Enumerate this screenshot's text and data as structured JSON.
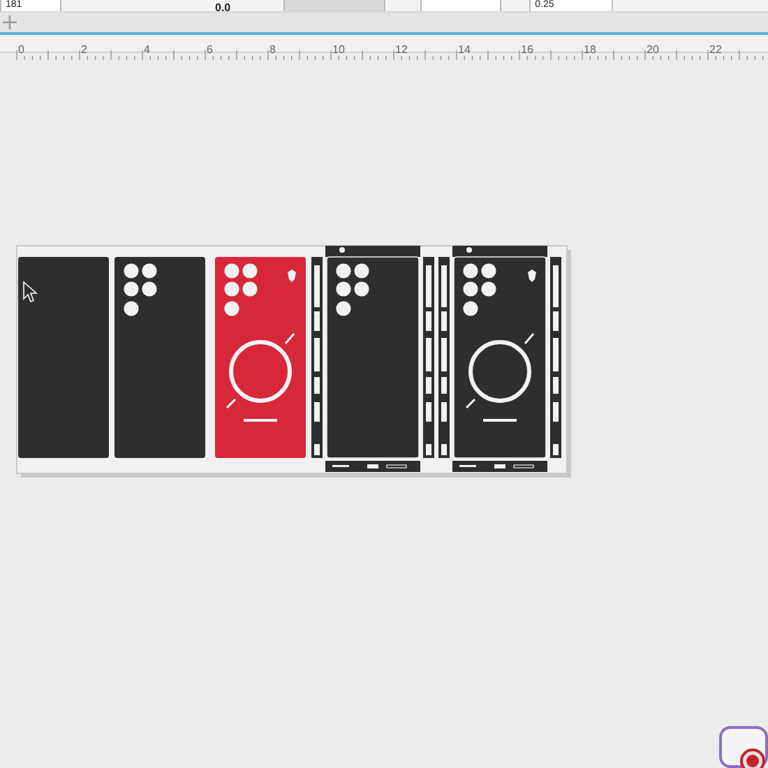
{
  "toolbar": {
    "fields": [
      {
        "kind": "input",
        "value": "181"
      },
      {
        "kind": "text",
        "value": "0.0"
      },
      {
        "kind": "input",
        "value": "0.25"
      }
    ]
  },
  "ruler": {
    "labels": [
      "0",
      "2",
      "4",
      "6",
      "8",
      "10",
      "12",
      "14",
      "16",
      "18",
      "20",
      "22"
    ]
  },
  "designs": [
    {
      "kind": "blank",
      "color": "#2e2d2f"
    },
    {
      "kind": "cameras",
      "color": "#2e2d2f"
    },
    {
      "kind": "logo",
      "color": "#d7283a"
    },
    {
      "kind": "wrap",
      "color": "#2e2d2f"
    },
    {
      "kind": "wrap-logo",
      "color": "#2e2d2f"
    }
  ]
}
